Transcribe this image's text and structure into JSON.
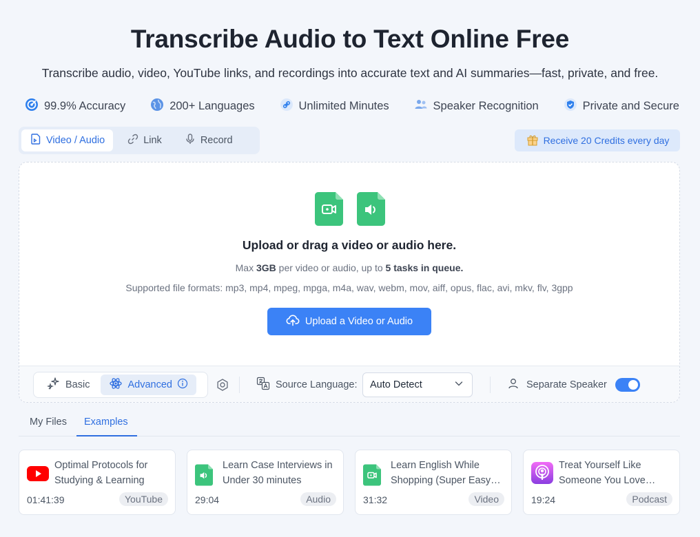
{
  "hero": {
    "title": "Transcribe Audio to Text Online Free",
    "subtitle": "Transcribe audio, video, YouTube links, and recordings into accurate text and AI summaries—fast, private, and free."
  },
  "features": [
    {
      "label": "99.9% Accuracy",
      "icon": "target-icon"
    },
    {
      "label": "200+ Languages",
      "icon": "globe-icon"
    },
    {
      "label": "Unlimited Minutes",
      "icon": "link-icon"
    },
    {
      "label": "Speaker Recognition",
      "icon": "people-icon"
    },
    {
      "label": "Private and Secure",
      "icon": "shield-icon"
    }
  ],
  "tabs": [
    {
      "label": "Video / Audio",
      "active": true
    },
    {
      "label": "Link",
      "active": false
    },
    {
      "label": "Record",
      "active": false
    }
  ],
  "credits_label": "Receive 20 Credits every day",
  "upload": {
    "title": "Upload or drag a video or audio here.",
    "limit_prefix": "Max ",
    "limit_size": "3GB",
    "limit_middle": " per video or audio, up to ",
    "limit_tasks": "5 tasks in queue.",
    "formats": "Supported file formats: mp3, mp4, mpeg, mpga, m4a, wav, webm, mov, aiff, opus, flac, avi, mkv, flv, 3gpp",
    "button_label": "Upload a Video or Audio"
  },
  "options": {
    "modes": [
      {
        "label": "Basic",
        "active": false
      },
      {
        "label": "Advanced",
        "active": true
      }
    ],
    "source_language_label": "Source Language:",
    "source_language_value": "Auto Detect",
    "separate_speaker_label": "Separate Speaker",
    "separate_speaker_on": true
  },
  "file_tabs": [
    {
      "label": "My Files",
      "active": false
    },
    {
      "label": "Examples",
      "active": true
    }
  ],
  "examples": [
    {
      "title": "Optimal Protocols for Studying & Learning",
      "duration": "01:41:39",
      "badge": "YouTube"
    },
    {
      "title": "Learn Case Interviews in Under 30 minutes",
      "duration": "29:04",
      "badge": "Audio"
    },
    {
      "title": "Learn English While Shopping (Super Easy English Lesson)",
      "duration": "31:32",
      "badge": "Video"
    },
    {
      "title": "Treat Yourself Like Someone You Love Podcast",
      "duration": "19:24",
      "badge": "Podcast"
    }
  ],
  "colors": {
    "accent": "#3b82f6",
    "accent_text": "#2f6fe0",
    "file_green": "#3cc47c",
    "youtube_red": "#ff0000",
    "podcast_purple": "#b552e8"
  }
}
